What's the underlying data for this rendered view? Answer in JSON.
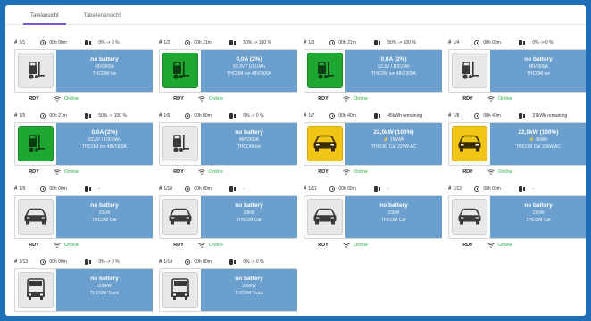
{
  "tabs": [
    "Tafelansicht",
    "Tabellenansicht"
  ],
  "active_tab": 0,
  "colors": {
    "frame": "#1e6fb8",
    "info_panel": "#6b9fcd",
    "green_state": "#1fa831",
    "yellow_state": "#f1c515",
    "online": "#2aa84a",
    "tab_accent": "#7b57d1"
  },
  "stations": [
    {
      "id": "1/1",
      "duration": "00h 00m",
      "soc": "0% -> 0 %",
      "icon": "forklift-icon",
      "state": "idle",
      "line1": "no battery",
      "line2": "48V/300A",
      "line3": "THCOM Ion",
      "status": "RDY",
      "net": "Online"
    },
    {
      "id": "1/2",
      "duration": "00h 21m",
      "soc": "50% -> 100 %",
      "icon": "forklift-icon",
      "state": "green",
      "line1": "0,0A (2%)",
      "line2": "53,3V / 100,0Ah",
      "line3": "THCOM ion 48V/300A",
      "status": "RDY",
      "net": "Online"
    },
    {
      "id": "1/3",
      "duration": "00h 21m",
      "soc": "50% -> 100 %",
      "icon": "forklift-icon",
      "state": "green",
      "line1": "0,0A (2%)",
      "line2": "53,3V / 100,0Ah",
      "line3": "THCOM ion 48V/300A",
      "status": "RDY",
      "net": "Online"
    },
    {
      "id": "1/4",
      "duration": "00h 00m",
      "soc": "0% -> 0 %",
      "icon": "forklift-icon",
      "state": "idle",
      "line1": "no battery",
      "line2": "48V/300A",
      "line3": "THCOM ion",
      "status": "RDY",
      "net": "Online"
    },
    {
      "id": "1/5",
      "duration": "00h 21m",
      "soc": "50% -> 100 %",
      "icon": "forklift-icon",
      "state": "green",
      "line1": "0,0A (2%)",
      "line2": "53,3V / 100,0Ah",
      "line3": "THCOM ion 48V/300A",
      "status": "RDY",
      "net": "Online"
    },
    {
      "id": "1/6",
      "duration": "00h 00m",
      "soc": "0% -> 0 %",
      "icon": "forklift-icon",
      "state": "idle",
      "line1": "no battery",
      "line2": "48V/300A",
      "line3": "THCOM ion",
      "status": "RDY",
      "net": "Online"
    },
    {
      "id": "1/7",
      "duration": "00h 40m",
      "soc": "45kWh remaining",
      "icon": "car-icon",
      "state": "yellow",
      "line1": "22,0kW (100%)",
      "line2": "⚡ 18kWh",
      "line3": "THCOM Car 22kW AC",
      "status": "RDY",
      "net": "Online"
    },
    {
      "id": "1/8",
      "duration": "00h 40m",
      "soc": "37kWh remaining",
      "icon": "car-icon",
      "state": "yellow",
      "line1": "22,0kW (100%)",
      "line2": "⚡ 8kWh",
      "line3": "THCOM Car 22kW AC",
      "status": "RDY",
      "net": "Online"
    },
    {
      "id": "1/9",
      "duration": "00h 00m",
      "soc": "-",
      "icon": "car-icon",
      "state": "idle",
      "line1": "no battery",
      "line2": "22kW",
      "line3": "THCOM Car",
      "status": "RDY",
      "net": "Online"
    },
    {
      "id": "1/10",
      "duration": "00h 00m",
      "soc": "-",
      "icon": "car-icon",
      "state": "idle",
      "line1": "no battery",
      "line2": "22kW",
      "line3": "THCOM Car",
      "status": "RDY",
      "net": "Online"
    },
    {
      "id": "1/11",
      "duration": "00h 00m",
      "soc": "-",
      "icon": "car-icon",
      "state": "idle",
      "line1": "no battery",
      "line2": "22kW",
      "line3": "THCOM Car",
      "status": "RDY",
      "net": "Online"
    },
    {
      "id": "1/12",
      "duration": "00h 00m",
      "soc": "-",
      "icon": "car-icon",
      "state": "idle",
      "line1": "no battery",
      "line2": "22kW",
      "line3": "THCOM Car",
      "status": "RDY",
      "net": "Online"
    },
    {
      "id": "1/13",
      "duration": "00h 00m",
      "soc": "0% -> 0 %",
      "icon": "truck-icon",
      "state": "idle",
      "line1": "no battery",
      "line2": "200kW",
      "line3": "THCOM Truck",
      "status": "RDY",
      "net": "Online"
    },
    {
      "id": "1/14",
      "duration": "00h 00m",
      "soc": "0% -> 0 %",
      "icon": "truck-icon",
      "state": "idle",
      "line1": "no battery",
      "line2": "200kW",
      "line3": "THCOM Truck",
      "status": "RDY",
      "net": "Online"
    }
  ]
}
